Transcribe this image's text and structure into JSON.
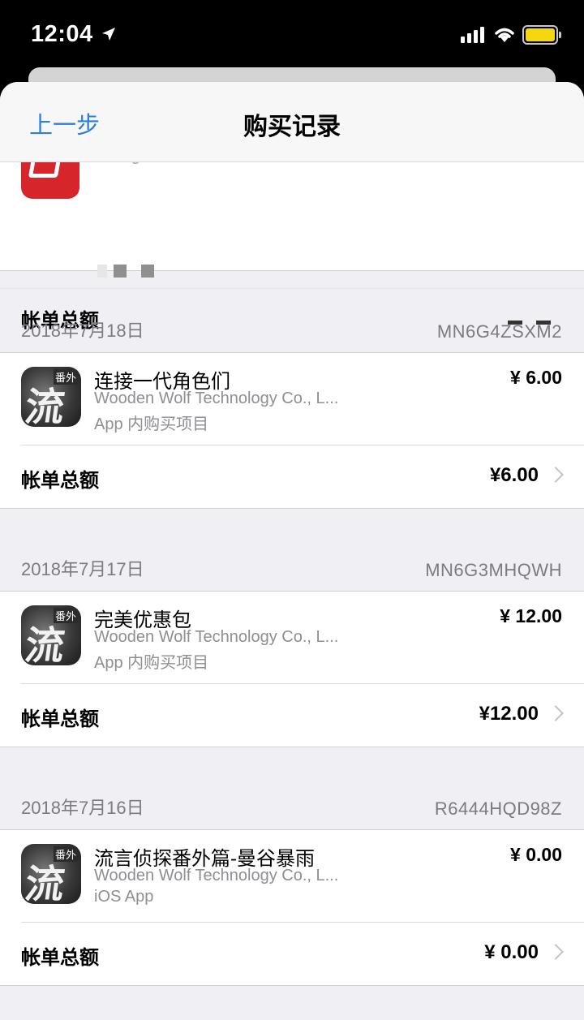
{
  "status_bar": {
    "time": "12:04"
  },
  "nav": {
    "back_label": "上一步",
    "title": "购买记录"
  },
  "partial_section": {
    "developer_partial": "Zhengzhou Lian Technolo",
    "total_label": "帐单总额"
  },
  "sections": [
    {
      "date": "2018年7月18日",
      "order_id": "MN6G4ZSXM2",
      "item": {
        "title": "连接一代角色们",
        "developer": "Wooden Wolf Technology Co., L...",
        "type": "App 内购买项目",
        "price": "¥ 6.00",
        "icon_glyph": "流",
        "icon_tag": "番外"
      },
      "total_label": "帐单总额",
      "total_value": "¥6.00"
    },
    {
      "date": "2018年7月17日",
      "order_id": "MN6G3MHQWH",
      "item": {
        "title": "完美优惠包",
        "developer": "Wooden Wolf Technology Co., L...",
        "type": "App 内购买项目",
        "price": "¥ 12.00",
        "icon_glyph": "流",
        "icon_tag": "番外"
      },
      "total_label": "帐单总额",
      "total_value": "¥12.00"
    },
    {
      "date": "2018年7月16日",
      "order_id": "R6444HQD98Z",
      "item": {
        "title": "流言侦探番外篇-曼谷暴雨",
        "developer": "Wooden Wolf Technology Co., L...",
        "type": "iOS App",
        "price": "¥ 0.00",
        "icon_glyph": "流",
        "icon_tag": "番外"
      },
      "total_label": "帐单总额",
      "total_value": "¥ 0.00"
    }
  ],
  "colors": {
    "accent": "#2d7fd8",
    "background": "#efeff4",
    "secondary_text": "#8e8e93"
  }
}
